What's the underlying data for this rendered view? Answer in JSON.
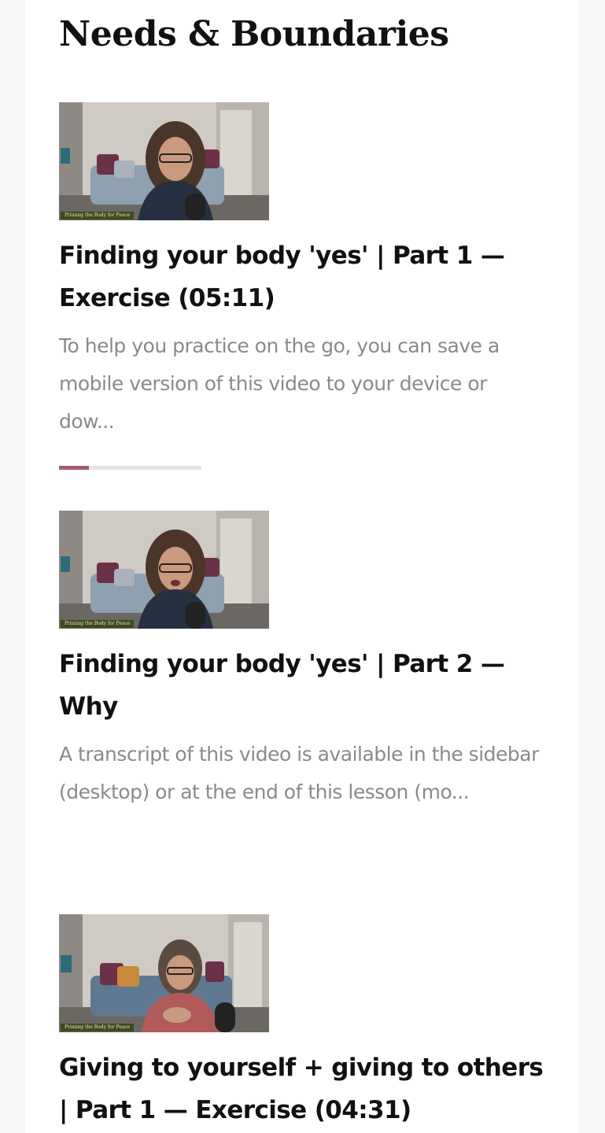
{
  "section": {
    "title": "Needs & Boundaries"
  },
  "lessons": [
    {
      "thumbnail_caption": "Priming the Body for Peace",
      "title": "Finding your body 'yes' | Part 1 — Exercise (05:11)",
      "description": "To help you practice on the go, you can save a mobile version of this video to your device or dow...",
      "progress": 0.21
    },
    {
      "thumbnail_caption": "Priming the Body for Peace",
      "title": "Finding your body 'yes' | Part 2 — Why",
      "description": "A transcript of this video is available in the sidebar (desktop) or at the end of this lesson (mo..."
    },
    {
      "thumbnail_caption": "Priming the Body for Peace",
      "title": "Giving to yourself + giving to others | Part 1 — Exercise (04:31)",
      "description": ""
    }
  ],
  "colors": {
    "progress_fill": "#a35a78",
    "progress_track": "#e5e5e5",
    "title_text": "#111111",
    "description_text": "#8a8a8a"
  }
}
